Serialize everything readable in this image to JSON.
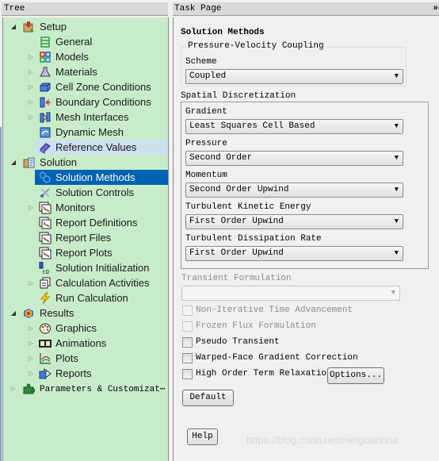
{
  "tree": {
    "header": "Tree",
    "items": [
      {
        "label": "Setup",
        "icon": "setup-icon",
        "level": 0,
        "expanded": true
      },
      {
        "label": "General",
        "icon": "general-icon",
        "level": 1
      },
      {
        "label": "Models",
        "icon": "models-icon",
        "level": 1,
        "expandable": true
      },
      {
        "label": "Materials",
        "icon": "materials-flask-icon",
        "level": 1,
        "expandable": true
      },
      {
        "label": "Cell Zone Conditions",
        "icon": "cell-zone-icon",
        "level": 1,
        "expandable": true
      },
      {
        "label": "Boundary Conditions",
        "icon": "boundary-conditions-icon",
        "level": 1,
        "expandable": true
      },
      {
        "label": "Mesh Interfaces",
        "icon": "mesh-interfaces-icon",
        "level": 1,
        "expandable": true
      },
      {
        "label": "Dynamic Mesh",
        "icon": "dynamic-mesh-icon",
        "level": 1
      },
      {
        "label": "Reference Values",
        "icon": "reference-values-book-icon",
        "level": 1,
        "highlight": "hover"
      },
      {
        "label": "Solution",
        "icon": "solution-icon",
        "level": 0,
        "expanded": true
      },
      {
        "label": "Solution Methods",
        "icon": "solution-methods-icon",
        "level": 1,
        "highlight": "selected"
      },
      {
        "label": "Solution Controls",
        "icon": "solution-controls-icon",
        "level": 1
      },
      {
        "label": "Monitors",
        "icon": "monitors-icon",
        "level": 1,
        "expandable": true
      },
      {
        "label": "Report Definitions",
        "icon": "report-definitions-icon",
        "level": 1
      },
      {
        "label": "Report Files",
        "icon": "report-files-icon",
        "level": 1
      },
      {
        "label": "Report Plots",
        "icon": "report-plots-icon",
        "level": 1
      },
      {
        "label": "Solution Initialization",
        "icon": "solution-initialization-icon",
        "level": 1
      },
      {
        "label": "Calculation Activities",
        "icon": "calculation-activities-icon",
        "level": 1,
        "expandable": true
      },
      {
        "label": "Run Calculation",
        "icon": "run-calculation-lightning-icon",
        "level": 1
      },
      {
        "label": "Results",
        "icon": "results-icon",
        "level": 0,
        "expanded": true
      },
      {
        "label": "Graphics",
        "icon": "graphics-palette-icon",
        "level": 1,
        "expandable": true
      },
      {
        "label": "Animations",
        "icon": "animations-film-icon",
        "level": 1,
        "expandable": true
      },
      {
        "label": "Plots",
        "icon": "plots-icon",
        "level": 1,
        "expandable": true
      },
      {
        "label": "Reports",
        "icon": "reports-icon",
        "level": 1,
        "expandable": true
      },
      {
        "label": "Parameters & Customizat⋯",
        "icon": "parameters-puzzle-icon",
        "level": 0,
        "expandable": true,
        "mono": true
      }
    ]
  },
  "task": {
    "header": "Task Page",
    "close_glyph": "»",
    "title": "Solution Methods",
    "pv_coupling": {
      "legend": "Pressure-Velocity Coupling",
      "scheme_label": "Scheme",
      "scheme_value": "Coupled"
    },
    "spatial": {
      "legend": "Spatial Discretization",
      "fields": [
        {
          "label": "Gradient",
          "value": "Least Squares Cell Based"
        },
        {
          "label": "Pressure",
          "value": "Second Order"
        },
        {
          "label": "Momentum",
          "value": "Second Order Upwind"
        },
        {
          "label": "Turbulent Kinetic Energy",
          "value": "First Order Upwind"
        },
        {
          "label": "Turbulent Dissipation Rate",
          "value": "First Order Upwind"
        }
      ]
    },
    "transient": {
      "label": "Transient Formulation",
      "value": ""
    },
    "checkboxes": [
      {
        "label": "Non-Iterative Time Advancement",
        "checked": false,
        "disabled": true
      },
      {
        "label": "Frozen Flux Formulation",
        "checked": false,
        "disabled": true
      },
      {
        "label": "Pseudo Transient",
        "checked": false,
        "disabled": false
      },
      {
        "label": "Warped-Face Gradient Correction",
        "checked": false,
        "disabled": false
      },
      {
        "label": "High Order Term Relaxation",
        "checked": false,
        "disabled": false
      }
    ],
    "options_button": "Options...",
    "default_button": "Default",
    "help_button": "Help"
  },
  "watermark": "https://blog.csdn.net/meiguanhua",
  "colors": {
    "tree_background": "#c8ecca",
    "selection": "#0063b1",
    "hover": "#cde0ee"
  }
}
